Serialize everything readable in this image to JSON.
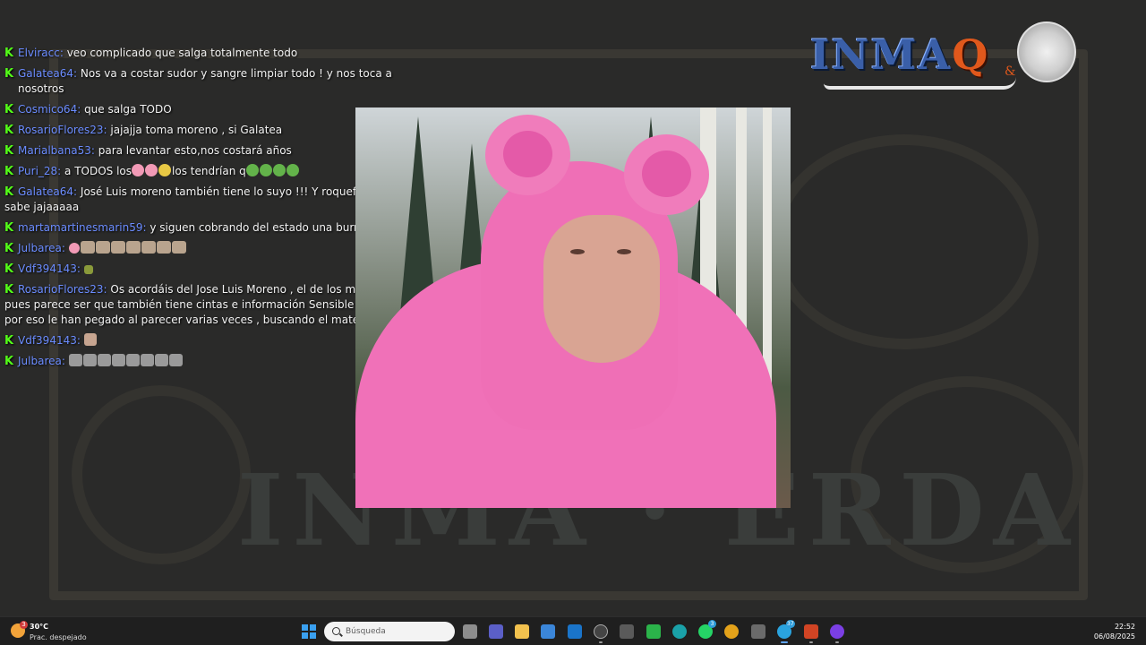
{
  "chat": {
    "messages": [
      {
        "user": "Elviracc:",
        "text": " veo complicado que salga totalmente todo"
      },
      {
        "user": "Galatea64:",
        "text": " Nos va a costar sudor y sangre limpiar todo ! y nos toca a nosotros"
      },
      {
        "user": "Cosmico64:",
        "text": " que salga TODO"
      },
      {
        "user": "RosarioFlores23:",
        "text": " jajajja toma moreno , si Galatea"
      },
      {
        "user": "Marialbana53:",
        "text": " para levantar esto,nos costará años"
      },
      {
        "user": "Puri_28:",
        "text_a": " a TODOS los",
        "text_b": "los tendrían q"
      },
      {
        "user": "Galatea64:",
        "text": " José Luis moreno también tiene lo suyo !!! Y roquefeler lo sabe jajaaaaa"
      },
      {
        "user": "martamartinesmarin59:",
        "text": " y siguen cobrando del estado una burrada"
      },
      {
        "user": "Julbarea:",
        "text": ""
      },
      {
        "user": "Vdf394143:",
        "text": ""
      },
      {
        "user": "RosarioFlores23:",
        "text": " Os acordáis del Jose Luis Moreno , el de los muñecos , pues parece ser que también tiene cintas e información Sensible de todos por eso le han pegado al parecer varias veces , buscando el material"
      },
      {
        "user": "Vdf394143:",
        "text": ""
      },
      {
        "user": "Julbarea:",
        "text": ""
      }
    ]
  },
  "logo": {
    "text_a": "INMA",
    "text_q": "Q",
    "amp": "&"
  },
  "taskbar": {
    "weather_temp": "30°C",
    "weather_desc": "Prac. despejado",
    "weather_badge": "3",
    "search_placeholder": "Búsqueda",
    "whatsapp_badge": "3",
    "telegram_badge": "37",
    "time": "22:52",
    "date": "06/08/2025"
  },
  "colors": {
    "username": "#6b8cff",
    "kick_green": "#53fc18",
    "accent": "#f071b8"
  }
}
